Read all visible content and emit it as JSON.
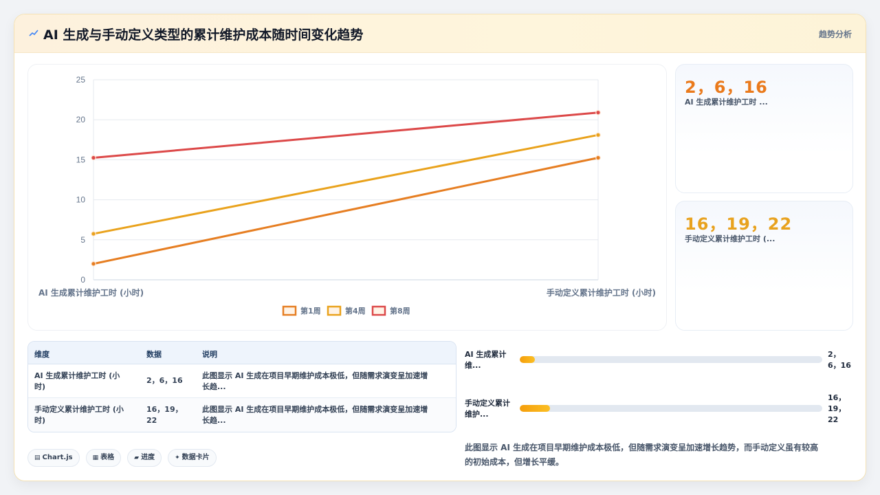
{
  "header": {
    "icon": "trend-icon",
    "title": "AI 生成与手动定义类型的累计维护成本随时间变化趋势",
    "tag": "趋势分析"
  },
  "kpis": [
    {
      "value": "2，6，16",
      "label": "AI 生成累计维护工时 ...",
      "color": "#ea7a1c"
    },
    {
      "value": "16，19，22",
      "label": "手动定义累计维护工时 (...",
      "color": "#e8a21e"
    }
  ],
  "chart_data": {
    "type": "line",
    "categories": [
      "AI 生成累计维护工时 (小时)",
      "手动定义累计维护工时 (小时)"
    ],
    "series": [
      {
        "name": "第1周",
        "values": [
          2,
          15.25
        ],
        "color": "#e67e22"
      },
      {
        "name": "第4周",
        "values": [
          5.75,
          18.1
        ],
        "color": "#e9a21c"
      },
      {
        "name": "第8周",
        "values": [
          15.25,
          20.9
        ],
        "color": "#dc4949"
      }
    ],
    "yticks": [
      0,
      5,
      10,
      15,
      20,
      25
    ],
    "ylim": [
      0,
      25
    ],
    "grid": true,
    "legend": "bottom"
  },
  "table": {
    "headers": [
      "维度",
      "数据",
      "说明"
    ],
    "rows": [
      {
        "dim_line1": "AI 生成累计维护工时 (小",
        "dim_line2": "时)",
        "data": "2，6，16",
        "desc_line1": "此图显示 AI 生成在项目早期维护成本极低，但随需求演变呈加速增",
        "desc_line2": "长趋..."
      },
      {
        "dim_line1": "手动定义累计维护工时 (小",
        "dim_line2": "时)",
        "data_line1": "16，19，",
        "data_line2": "22",
        "desc_line1": "此图显示 AI 生成在项目早期维护成本极低，但随需求演变呈加速增",
        "desc_line2": "长趋..."
      }
    ]
  },
  "progress": [
    {
      "label_line1": "AI 生成累计",
      "label_line2": "维...",
      "val_line1": "2，",
      "val_line2": "6，16",
      "fraction": 0.05
    },
    {
      "label_line1": "手动定义累计",
      "label_line2": "维护...",
      "val_line1": "16，",
      "val_line2": "19，",
      "val_line3": "22",
      "fraction": 0.1
    }
  ],
  "description_line1": "此图显示 AI 生成在项目早期维护成本极低，但随需求演变呈加速增长趋势，而手动定义虽有较高",
  "description_line2": "的初始成本，但增长平缓。",
  "chips": [
    {
      "icon": "chart-icon",
      "glyph": "▤",
      "label": "Chart.js"
    },
    {
      "icon": "table-icon",
      "glyph": "▦",
      "label": "表格"
    },
    {
      "icon": "progress-icon",
      "glyph": "▰",
      "label": "进度"
    },
    {
      "icon": "sparkle-icon",
      "glyph": "✦",
      "label": "数据卡片"
    }
  ]
}
